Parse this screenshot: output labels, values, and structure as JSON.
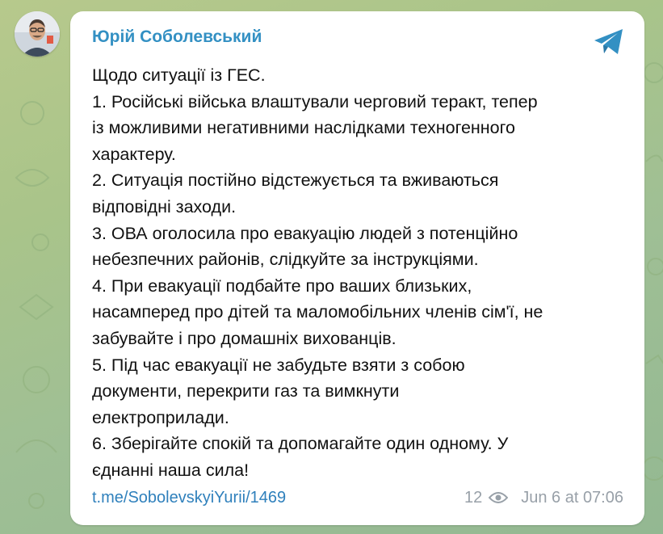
{
  "post": {
    "author": "Юрій Соболевський",
    "lines": [
      "Щодо ситуації із ГЕС.",
      "1. Російські війська влаштували черговий теракт, тепер",
      "із можливими негативними наслідками техногенного",
      "характеру.",
      "2. Ситуація постійно відстежується та вживаються",
      "відповідні заходи.",
      "3. ОВА оголосила про евакуацію людей з потенційно",
      "небезпечних районів, слідкуйте за інструкціями.",
      "4. При евакуації подбайте про ваших близьких,",
      "насамперед про дітей та маломобільних членів сім'ї, не",
      "забувайте і про домашніх вихованців.",
      "5. Під час евакуації не забудьте взяти з собою",
      "документи, перекрити газ та вимкнути",
      "електроприлади.",
      "6. Зберігайте спокій та допомагайте один одному. У",
      "єднанні наша сила!"
    ],
    "link": "t.me/SobolevskyiYurii/1469",
    "views": "12",
    "date": "Jun 6 at 07:06"
  },
  "icons": {
    "share": "telegram-plane-icon",
    "views": "eye-icon",
    "avatar": "avatar"
  },
  "colors": {
    "accent": "#3390c3",
    "link": "#2f80bc",
    "meta": "#98a0a8",
    "text": "#111111",
    "background": "#a9c48a"
  }
}
